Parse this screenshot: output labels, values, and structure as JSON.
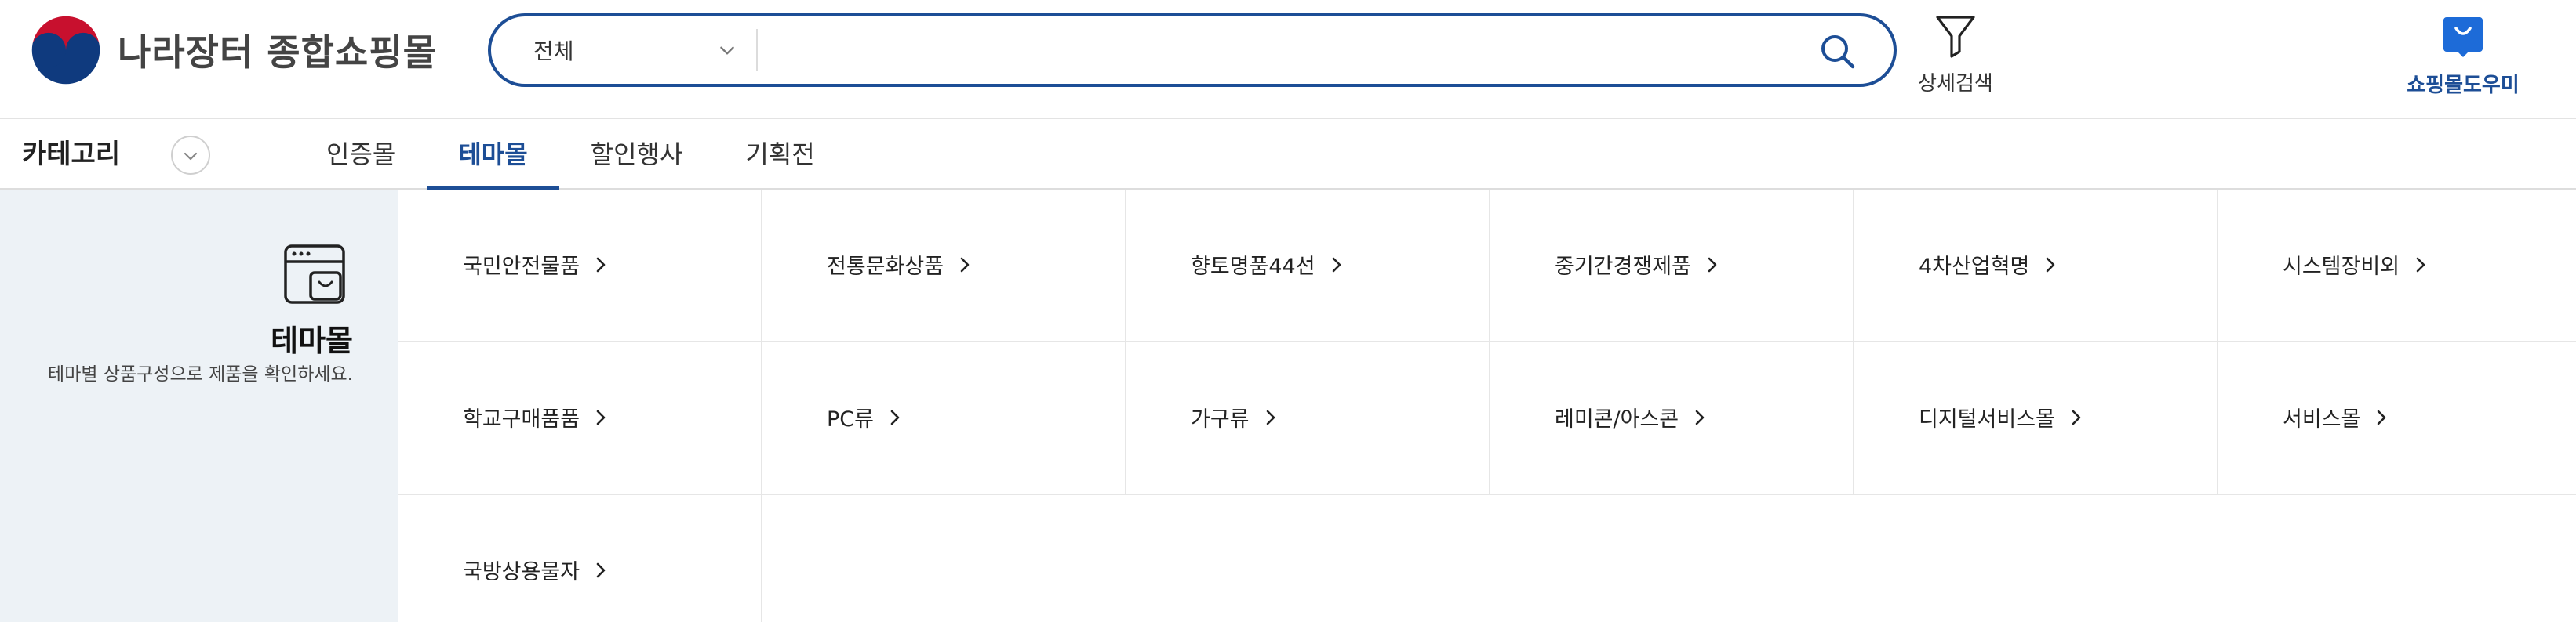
{
  "logo": {
    "text": "나라장터 종합쇼핑몰",
    "colors": {
      "red": "#c8102e",
      "blue": "#0f3a7e"
    }
  },
  "search": {
    "category_value": "전체",
    "placeholder": "",
    "button_icon": "search-icon"
  },
  "header_actions": {
    "advanced_search_label": "상세검색",
    "advanced_search_icon": "filter-icon",
    "helper_label": "쇼핑몰도우미",
    "helper_icon": "shopping-bag-icon"
  },
  "nav": {
    "category_label": "카테고리",
    "tabs": [
      {
        "label": "인증몰",
        "active": false
      },
      {
        "label": "테마몰",
        "active": true
      },
      {
        "label": "할인행사",
        "active": false
      },
      {
        "label": "기획전",
        "active": false
      }
    ]
  },
  "theme_panel": {
    "icon": "browser-bag-icon",
    "title": "테마몰",
    "description": "테마별 상품구성으로 제품을 확인하세요."
  },
  "theme_items": [
    "국민안전물품",
    "전통문화상품",
    "향토명품44선",
    "중기간경쟁제품",
    "4차산업혁명",
    "시스템장비외",
    "학교구매품품",
    "PC류",
    "가구류",
    "레미콘/아스콘",
    "디지털서비스몰",
    "서비스몰",
    "국방상용물자"
  ],
  "colors": {
    "brand_blue": "#1d4e96",
    "panel_bg": "#edf2f6",
    "border": "#e6e6e6"
  }
}
